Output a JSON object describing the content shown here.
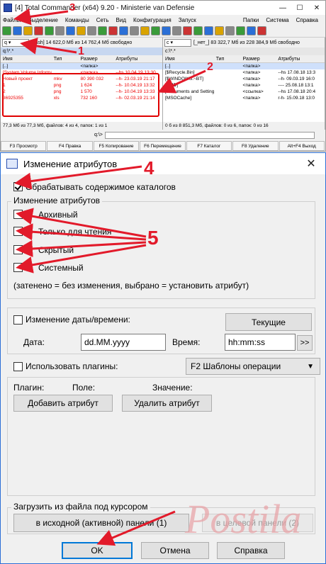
{
  "tc": {
    "title": "[4] Total Commander (x64) 9.20 - Ministerie van Defensie",
    "menu": [
      "Файлы",
      "Выделение",
      "Команды",
      "Сеть",
      "Вид",
      "Конфигурация",
      "Запуск"
    ],
    "menu_right": [
      "Папки",
      "Система",
      "Справка"
    ],
    "left": {
      "drive": "q",
      "drive_label": "[flash]",
      "free": "14 622,0 Мб из 14 762,4 Мб свободно",
      "path": "q:\\*.*",
      "cols": [
        "Имя",
        "Тип",
        "Размер",
        "Атрибуты"
      ],
      "rows": [
        {
          "name": "[..]",
          "type": "",
          "size": "<папка>",
          "attr": "",
          "red": false
        },
        {
          "name": "[System Volume Information]",
          "type": "",
          "size": "<папка>",
          "attr": "--hs 10.04.19 13:30",
          "red": true
        },
        {
          "name": "Новый проект",
          "type": "mkv",
          "size": "80 390 032",
          "attr": "--h- 23.03.19 21:17",
          "red": true
        },
        {
          "name": "1",
          "type": "png",
          "size": "1 624",
          "attr": "--h- 10.04.19 13:32",
          "red": true
        },
        {
          "name": "2",
          "type": "png",
          "size": "1 570",
          "attr": "--h- 10.04.19 13:33",
          "red": true
        },
        {
          "name": "36925355",
          "type": "xls",
          "size": "732 160",
          "attr": "--h- 02.03.19 21:14",
          "red": true
        }
      ],
      "status": "77,3 Мб из 77,3 Мб, файлов: 4 из 4, папок: 1 из 1"
    },
    "right": {
      "drive": "c",
      "drive_label": "[_нет_]",
      "free": "83 322,7 Мб из 228 384,9 Мб свободно",
      "path": "c:\\*.*",
      "cols": [
        "Имя",
        "Тип",
        "Размер",
        "Атрибуты"
      ],
      "rows": [
        {
          "name": "[..]",
          "type": "",
          "size": "<папка>",
          "attr": "",
          "red": false
        },
        {
          "name": "[$Recycle.Bin]",
          "type": "",
          "size": "<папка>",
          "attr": "--hs 17.08.18 13:3",
          "red": false
        },
        {
          "name": "[$WINDOWS.~BT]",
          "type": "",
          "size": "<папка>",
          "attr": "--h- 09.03.19 16:0",
          "red": false
        },
        {
          "name": "[AMD]",
          "type": "",
          "size": "<папка>",
          "attr": "---- 25.08.18 13:1",
          "red": false
        },
        {
          "name": "[Documents and Settings]",
          "type": "",
          "size": "<ссылка>",
          "attr": "--hs 17.08.18 20:4",
          "red": false
        },
        {
          "name": "[MSOCache]",
          "type": "",
          "size": "<папка>",
          "attr": "r-h- 15.09.18 13:0",
          "red": false
        }
      ],
      "status": "0 б из 8 851,3 Мб, файлов: 0 из 6, папок: 0 из 16"
    },
    "cmd_prompt": "q:\\>",
    "fkeys": [
      "F3 Просмотр",
      "F4 Правка",
      "F5 Копирование",
      "F6 Перемещение",
      "F7 Каталог",
      "F8 Удаление",
      "Alt+F4 Выход"
    ]
  },
  "dialog": {
    "title": "Изменение атрибутов",
    "close": "✕",
    "process_subdirs": "Обрабатывать содержимое каталогов",
    "attrs_group": "Изменение атрибутов",
    "attrs": [
      {
        "key": "a",
        "label": "Архивный"
      },
      {
        "key": "r",
        "label": "Только для чтения"
      },
      {
        "key": "h",
        "label": "Скрытый"
      },
      {
        "key": "s",
        "label": "Системный"
      }
    ],
    "hint": "(затенено = без изменения, выбрано = установить атрибут)",
    "change_datetime": "Изменение даты/времени:",
    "current_btn": "Текущие",
    "date_label": "Дата:",
    "date_value": "dd.MM.yyyy",
    "time_label": "Время:",
    "time_value": "hh:mm:ss",
    "more_btn": ">>",
    "use_plugins": "Использовать плагины:",
    "templates_select": "F2 Шаблоны операции",
    "plugin_col": "Плагин:",
    "field_col": "Поле:",
    "value_col": "Значение:",
    "add_attr_btn": "Добавить атрибут",
    "del_attr_btn": "Удалить атрибут",
    "load_group": "Загрузить из файла под курсором",
    "src_panel_btn": "в исходной (активной) панели (1)",
    "target_panel_btn": "в целевой панели (2)",
    "ok": "OK",
    "cancel": "Отмена",
    "help": "Справка"
  },
  "annotations": [
    "1",
    "2",
    "3",
    "4",
    "5"
  ],
  "colors": {
    "annot": "#e21a2a",
    "accent": "#0078d7",
    "highlight": "#e00000"
  }
}
